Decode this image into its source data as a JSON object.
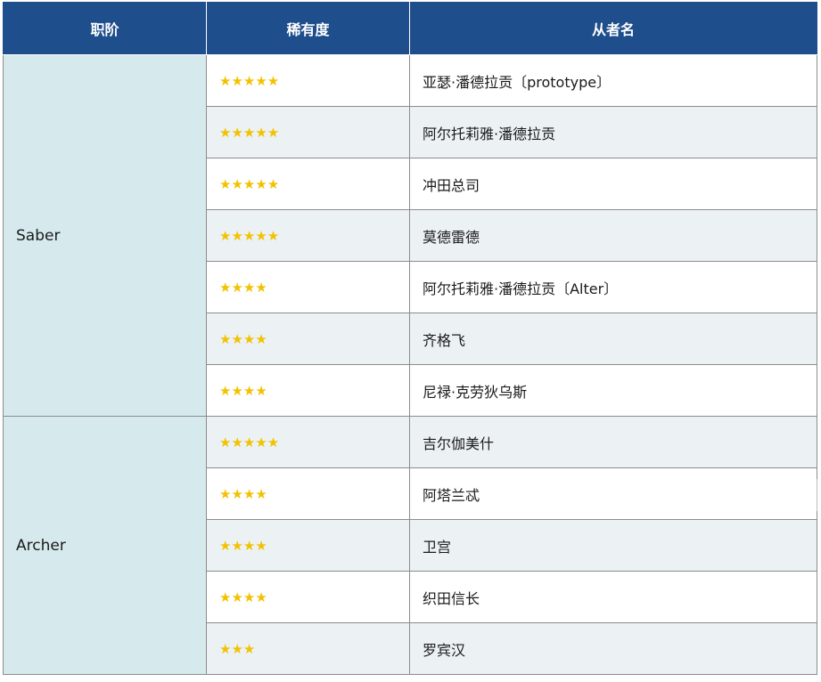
{
  "table": {
    "headers": [
      "职阶",
      "稀有度",
      "从者名"
    ],
    "groups": [
      {
        "class": "Saber",
        "rows": [
          {
            "rarity": "★★★★★",
            "name": "亚瑟·潘德拉贡〔prototype〕"
          },
          {
            "rarity": "★★★★★",
            "name": "阿尔托莉雅·潘德拉贡"
          },
          {
            "rarity": "★★★★★",
            "name": "冲田总司"
          },
          {
            "rarity": "★★★★★",
            "name": "莫德雷德"
          },
          {
            "rarity": "★★★★",
            "name": "阿尔托莉雅·潘德拉贡〔Alter〕"
          },
          {
            "rarity": "★★★★",
            "name": "齐格飞"
          },
          {
            "rarity": "★★★★",
            "name": "尼禄·克劳狄乌斯"
          }
        ]
      },
      {
        "class": "Archer",
        "rows": [
          {
            "rarity": "★★★★★",
            "name": "吉尔伽美什"
          },
          {
            "rarity": "★★★★",
            "name": "阿塔兰忒"
          },
          {
            "rarity": "★★★★",
            "name": "卫宫"
          },
          {
            "rarity": "★★★★",
            "name": "织田信长"
          },
          {
            "rarity": "★★★",
            "name": "罗宾汉"
          }
        ]
      }
    ]
  },
  "colors": {
    "header_bg": "#1f4e8c",
    "class_cell_bg": "#d6eaee",
    "stripe_bg": "#ecf1f4",
    "star": "#f2c200"
  }
}
